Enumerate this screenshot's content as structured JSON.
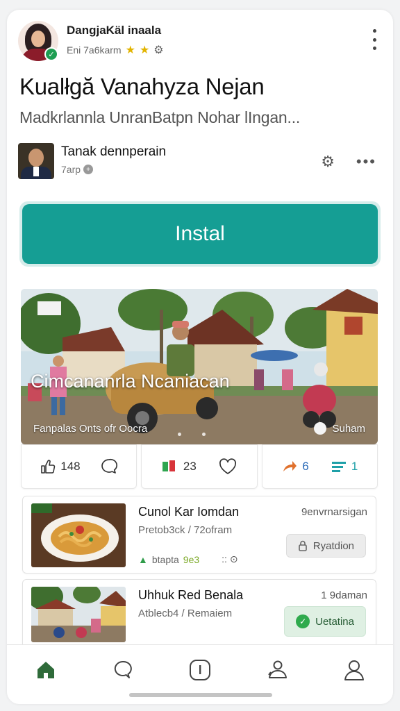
{
  "header": {
    "app_name": "DangjaKäl inaala",
    "subtitle": "Eni 7a6karm"
  },
  "title": "Kualłgă Vanahyza Nejan",
  "subtitle": "Madkrlannla UnranBatpn Nohar lIngan...",
  "author": {
    "name": "Tanak  dennperain",
    "time": "7arp"
  },
  "install_label": "Instal",
  "hero": {
    "caption": "Cimcananrla Ncaniacan",
    "meta": "Fanpalas Onts ofr Oocra",
    "user": "Suham"
  },
  "actions": {
    "likes": "148",
    "shares": "23",
    "forward_count": "6",
    "list_count": "1"
  },
  "items": [
    {
      "title": "Cunol Kar Iomdan",
      "subtitle": "Pretob3ck / 72ofram",
      "right": "9envrnarsigan",
      "meta_a": "btapta",
      "meta_b": "9e3",
      "meta_c": ":: ⊙",
      "chip": "Ryatdion"
    },
    {
      "title": "Uhhuk Red Benala",
      "subtitle": "Atblecb4 / Remaiem",
      "right": "1 9daman",
      "chip": "Uetatina"
    }
  ],
  "colors": {
    "install": "#159e94",
    "verified": "#1e9e52",
    "star": "#e2b400",
    "nav_home": "#2f6b3a"
  },
  "icons": [
    "verified-icon",
    "star-icon",
    "gear-icon",
    "more-icon",
    "like-icon",
    "comment-icon",
    "share-icon",
    "heart-icon",
    "forward-icon",
    "list-icon",
    "home-icon",
    "chat-icon",
    "info-icon",
    "profile-pin-icon",
    "user-icon"
  ]
}
